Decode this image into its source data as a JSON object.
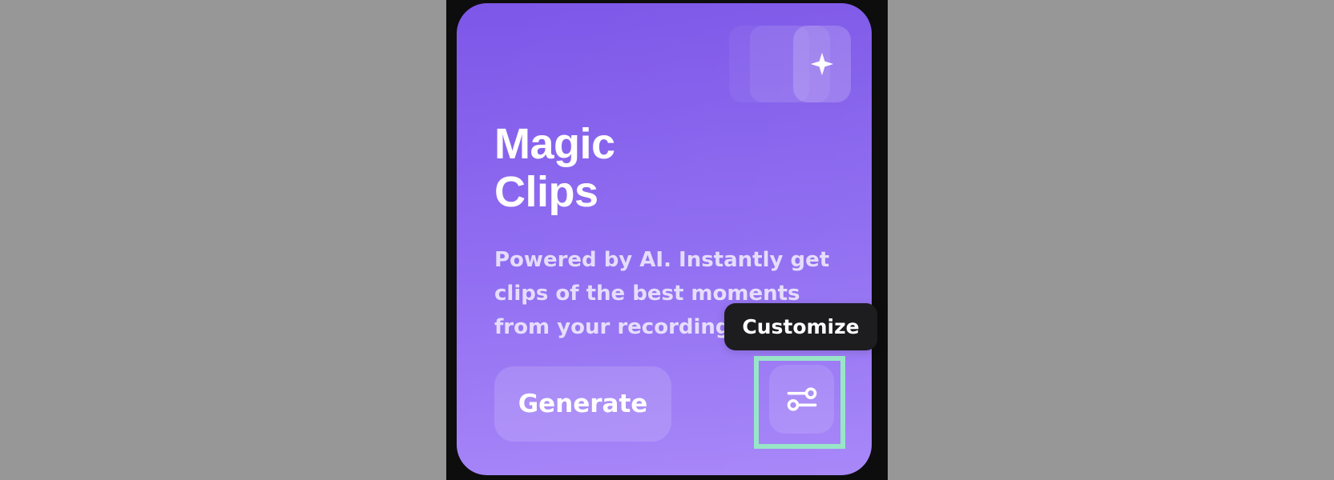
{
  "card": {
    "title_line_1": "Magic",
    "title_line_2": "Clips",
    "description_lines": [
      "Powered by AI. Instantly get",
      "clips of the best moments",
      "from your recording."
    ],
    "generate_label": "Generate",
    "sparkle_icon": "sparkle-icon",
    "customize_icon": "sliders-icon"
  },
  "tooltip": {
    "label": "Customize"
  },
  "colors": {
    "page_background": "#979797",
    "frame_background": "#0d0d0d",
    "card_top": "#7a53e8",
    "card_bottom": "#a17ef8",
    "tooltip_background": "#1d1d1f",
    "highlight_outline": "#98e6c7"
  }
}
